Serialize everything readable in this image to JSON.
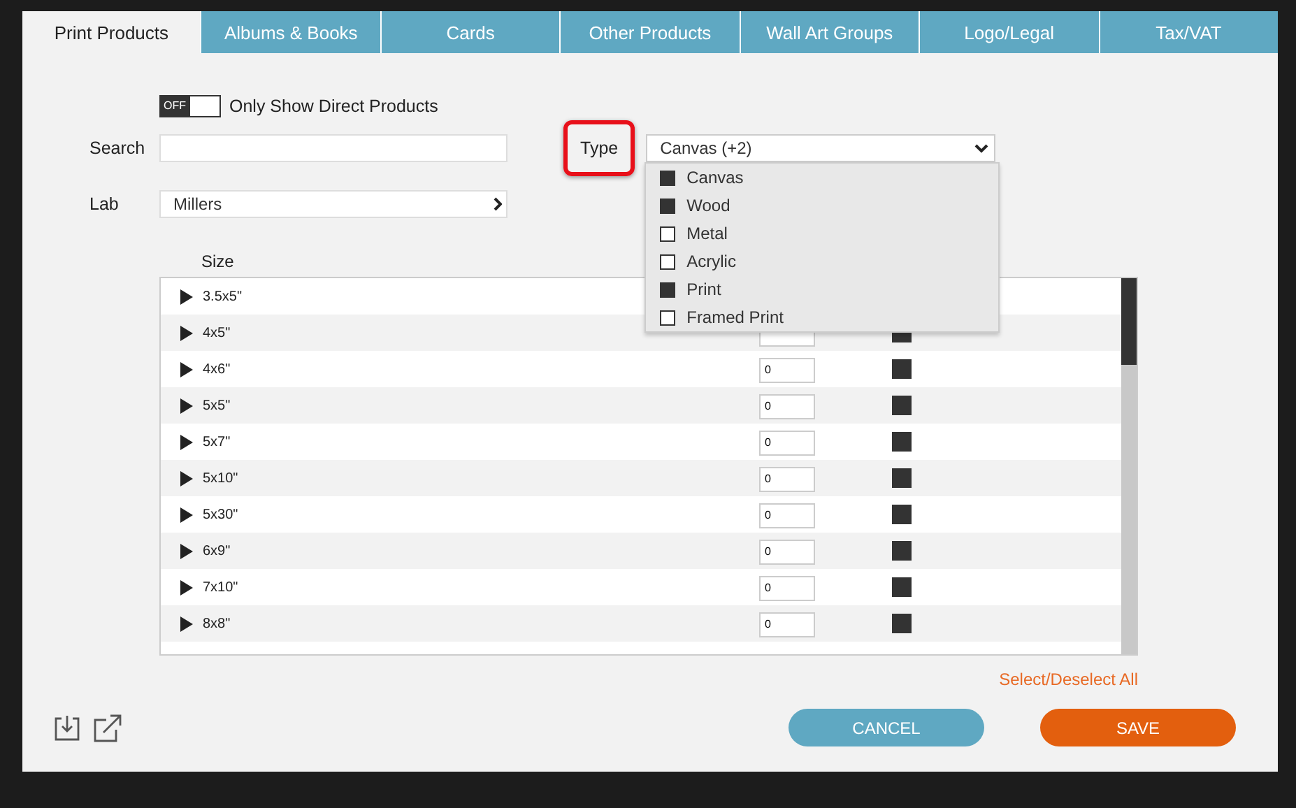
{
  "tabs": [
    {
      "label": "Print Products",
      "selected": true
    },
    {
      "label": "Albums & Books",
      "selected": false
    },
    {
      "label": "Cards",
      "selected": false
    },
    {
      "label": "Other Products",
      "selected": false
    },
    {
      "label": "Wall Art Groups",
      "selected": false
    },
    {
      "label": "Logo/Legal",
      "selected": false
    },
    {
      "label": "Tax/VAT",
      "selected": false
    }
  ],
  "direct_toggle": {
    "state": "OFF",
    "on": false,
    "label": "Only Show Direct Products"
  },
  "search": {
    "label": "Search"
  },
  "type": {
    "label": "Type",
    "highlighted": true,
    "value": "Canvas (+2)",
    "expanded": true,
    "options": [
      {
        "label": "Canvas",
        "checked": true
      },
      {
        "label": "Wood",
        "checked": true
      },
      {
        "label": "Metal",
        "checked": false
      },
      {
        "label": "Acrylic",
        "checked": false
      },
      {
        "label": "Print",
        "checked": true
      },
      {
        "label": "Framed Print",
        "checked": false
      }
    ]
  },
  "lab": {
    "label": "Lab",
    "value": "Millers"
  },
  "table": {
    "columns": [
      "Size"
    ],
    "rows": [
      {
        "size": "3.5x5\""
      },
      {
        "size": "4x5\"",
        "checked": true
      },
      {
        "size": "4x6\"",
        "qty": "0",
        "checked": true
      },
      {
        "size": "5x5\"",
        "qty": "0",
        "checked": true
      },
      {
        "size": "5x7\"",
        "qty": "0",
        "checked": true
      },
      {
        "size": "5x10\"",
        "qty": "0",
        "checked": true
      },
      {
        "size": "5x30\"",
        "qty": "0",
        "checked": true
      },
      {
        "size": "6x9\"",
        "qty": "0",
        "checked": true
      },
      {
        "size": "7x10\"",
        "qty": "0",
        "checked": true
      },
      {
        "size": "8x8\"",
        "qty": "0",
        "checked": true
      }
    ]
  },
  "select_all": "Select/Deselect All",
  "buttons": [
    {
      "label": "CANCEL",
      "kind": "secondary"
    },
    {
      "label": "SAVE",
      "kind": "primary"
    }
  ]
}
